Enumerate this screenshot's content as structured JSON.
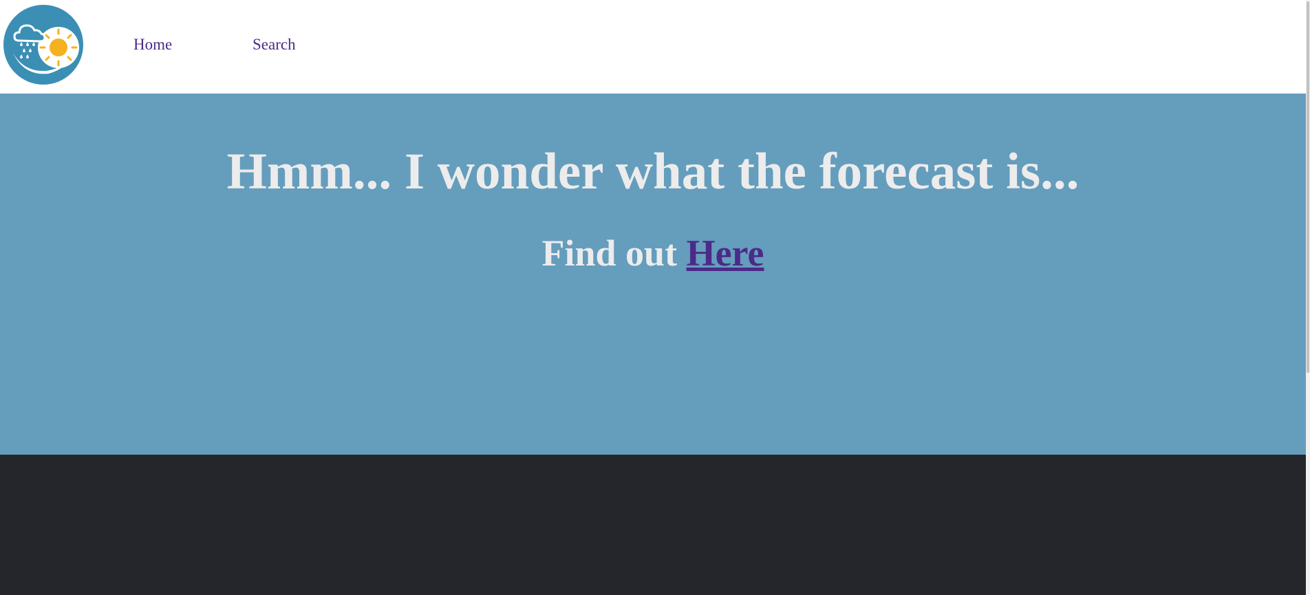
{
  "header": {
    "logo_icon": "weather-logo-icon",
    "nav": {
      "home_label": "Home",
      "search_label": "Search"
    }
  },
  "hero": {
    "title": "Hmm... I wonder what the forecast is...",
    "subtitle_prefix": "Find out ",
    "subtitle_link": "Here"
  },
  "colors": {
    "header_bg": "#ffffff",
    "hero_bg": "#659dbd",
    "footer_bg": "#25262b",
    "link": "#4b2a88",
    "hero_text": "#ececec",
    "logo_circle": "#3b8fb5",
    "sun": "#f5b120"
  }
}
